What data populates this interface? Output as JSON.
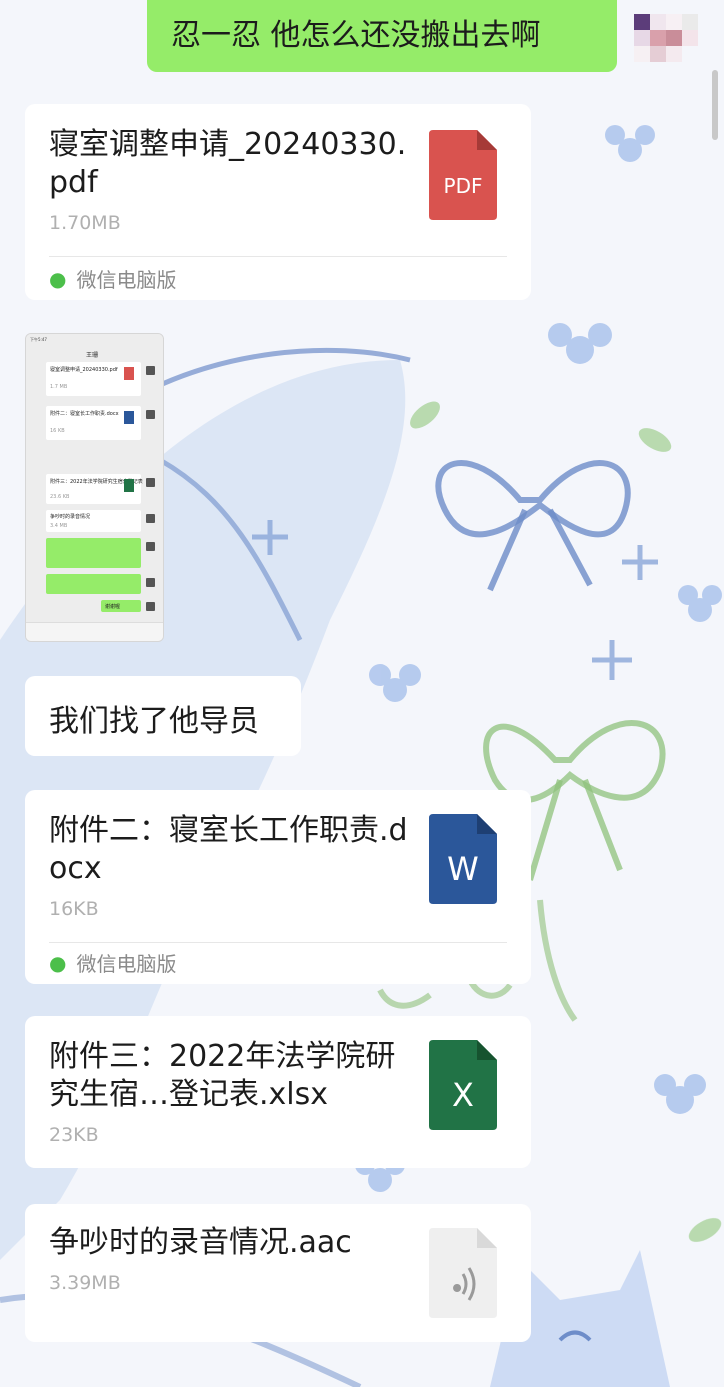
{
  "chat": {
    "top_message": "忍一忍 他怎么还没搬出去啊",
    "message_text": "我们找了他导员",
    "source_label": "微信电脑版",
    "files": [
      {
        "name": "寝室调整申请_20240330.pdf",
        "size": "1.70MB",
        "type": "PDF"
      },
      {
        "name": "附件二：寝室长工作职责.docx",
        "size": "16KB",
        "type": "W"
      },
      {
        "name": "附件三：2022年法学院研究生宿…登记表.xlsx",
        "size": "23KB",
        "type": "X"
      },
      {
        "name": "争吵时的录音情况.aac",
        "size": "3.39MB",
        "type": "audio"
      }
    ]
  },
  "thumbnail": {
    "status_time": "下午5:47",
    "header_title": "王珊",
    "items": [
      {
        "text": "寝室调整申请_20240330.pdf",
        "size": "1.7 MB"
      },
      {
        "text": "附件二：寝室长工作职责.docx",
        "size": "16 KB"
      },
      {
        "text": "附件三：2022年法学院研究生宿舍登记表",
        "size": "23.6 KB"
      },
      {
        "text": "争吵时的录音情况",
        "size": "3.4 MB"
      }
    ],
    "bottom_label": "谢谢喔"
  },
  "colors": {
    "green_bubble": "#95ec69",
    "pdf": "#d9534f",
    "word": "#2b579a",
    "excel": "#217346",
    "audio": "#efefef"
  }
}
